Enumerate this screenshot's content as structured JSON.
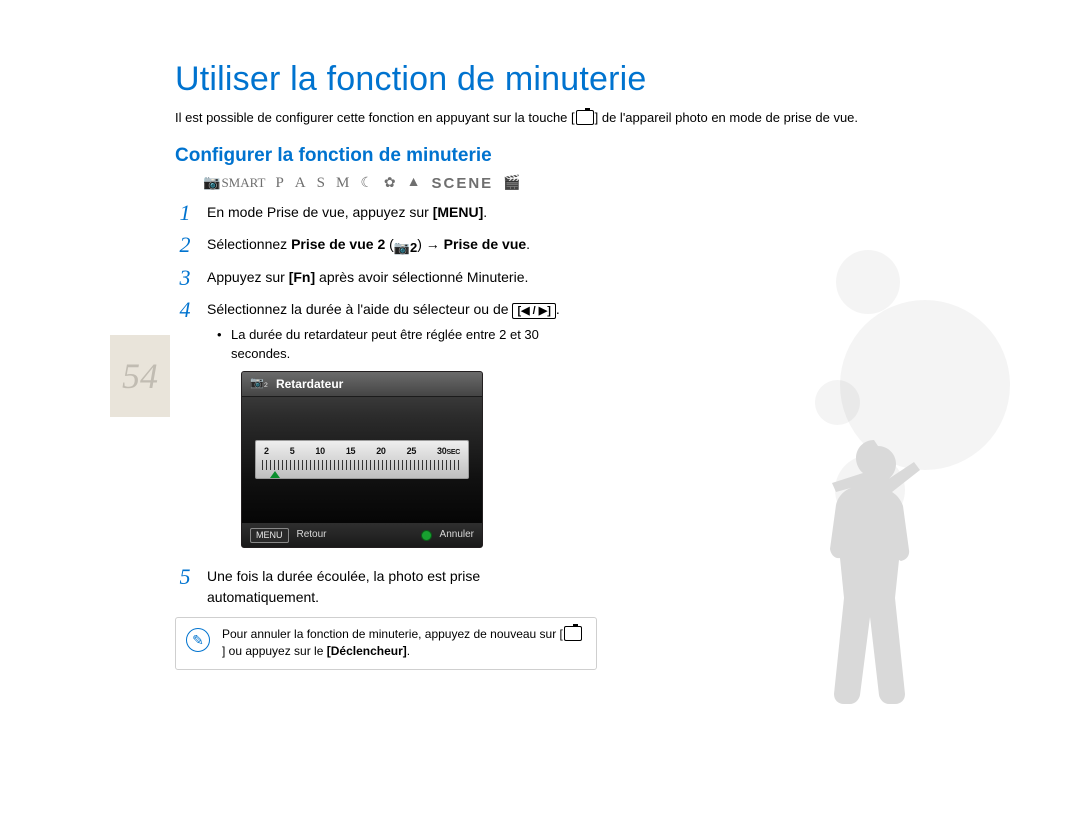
{
  "page_number": "54",
  "title": "Utiliser la fonction de minuterie",
  "intro_prefix": "Il est possible de configurer cette fonction en appuyant sur la touche [",
  "intro_suffix": "] de l'appareil photo en mode de prise de vue.",
  "subtitle": "Configurer la fonction de minuterie",
  "modes": {
    "smart": "SMART",
    "p": "P",
    "a": "A",
    "s": "S",
    "m": "M",
    "scene": "SCENE"
  },
  "steps": {
    "s1a": "En mode Prise de vue, appuyez sur ",
    "s1b": "[MENU]",
    "s1c": ".",
    "s2a": "Sélectionnez ",
    "s2b": "Prise de vue 2",
    "s2c": " (",
    "s2d": ") → ",
    "s2e": "Prise de vue",
    "s2f": ".",
    "s3a": "Appuyez sur ",
    "s3b": "[Fn]",
    "s3c": " après avoir sélectionné Minuterie.",
    "s4a": "Sélectionnez la durée à l'aide du sélecteur ou de ",
    "s4b": "[◀ / ▶]",
    "s4c": ".",
    "s4_sub": "La durée du retardateur peut être réglée entre 2 et 30 secondes.",
    "s5": "Une fois la durée écoulée, la photo est prise automatiquement."
  },
  "lcd": {
    "header_icon": "📷₂",
    "header_title": "Retardateur",
    "ticks": {
      "t1": "2",
      "t2": "5",
      "t3": "10",
      "t4": "15",
      "t5": "20",
      "t6": "25",
      "t7": "30",
      "unit": "SEC"
    },
    "footer_menu": "MENU",
    "footer_back": "Retour",
    "footer_cancel": "Annuler"
  },
  "note": {
    "line1": "Pour annuler la fonction de minuterie, appuyez de nouveau sur [",
    "line2": "] ou appuyez sur le ",
    "line3": "[Déclencheur]",
    "line4": "."
  },
  "icons": {
    "cam2": "📷2"
  }
}
